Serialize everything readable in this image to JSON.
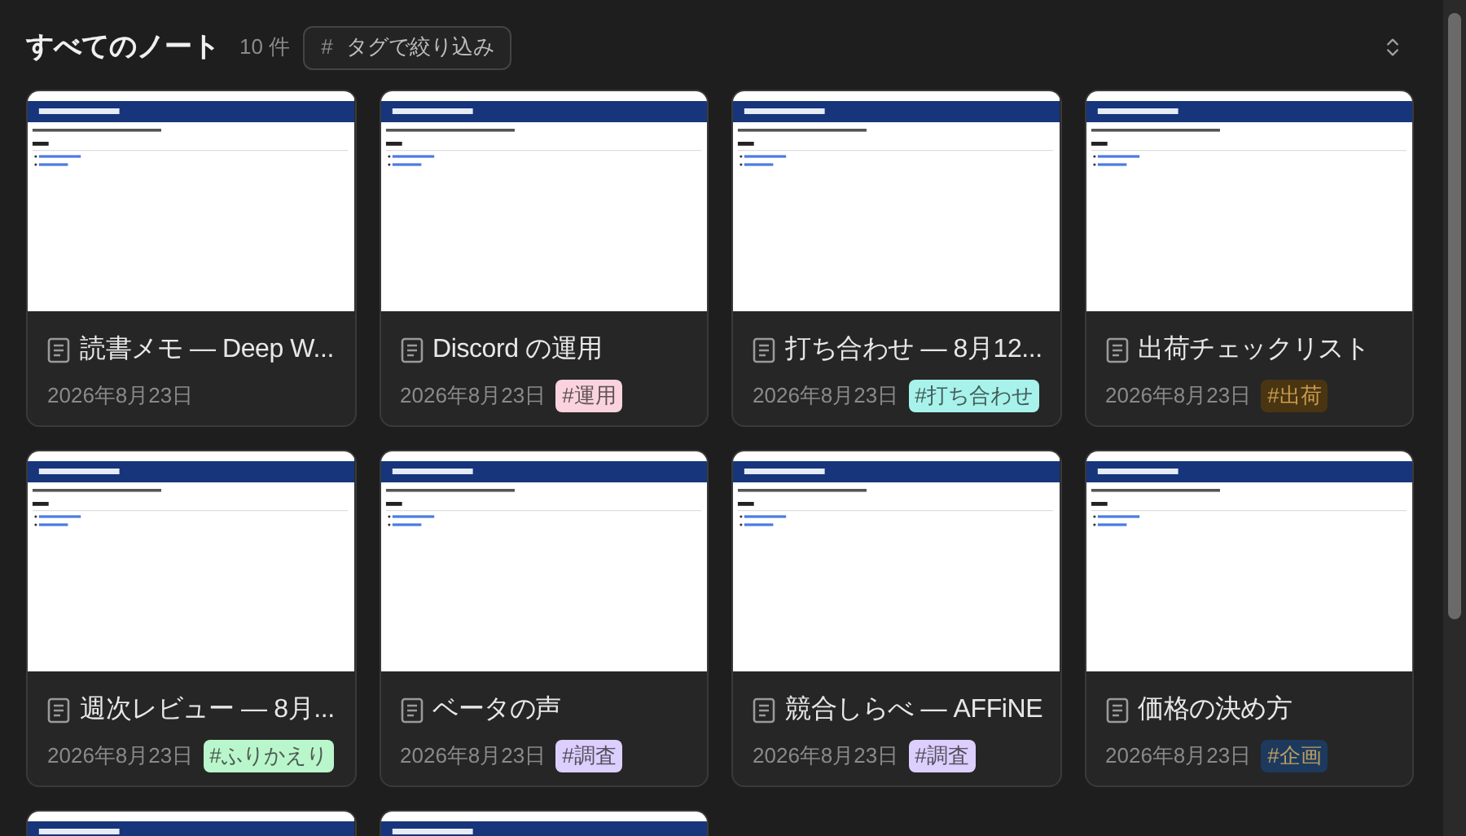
{
  "header": {
    "title": "すべてのノート",
    "count": "10 件",
    "filter_button": {
      "icon": "#",
      "label": "タグで絞り込み"
    }
  },
  "notes": [
    {
      "kind": "full",
      "title": "読書メモ — Deep W...",
      "date": "2026年8月23日"
    },
    {
      "kind": "full",
      "title": "Discord の運用",
      "date": "2026年8月23日",
      "tag": {
        "label": "運用",
        "color": "#fbd3df"
      }
    },
    {
      "kind": "full",
      "title": "打ち合わせ — 8月12...",
      "date": "2026年8月23日",
      "tag": {
        "label": "打ち合わせ",
        "color": "#a7f3eb"
      }
    },
    {
      "kind": "full",
      "title": "出荷チェックリスト",
      "date": "2026年8月23日",
      "tag": {
        "label": "出荷",
        "color": "#4a3512"
      }
    },
    {
      "kind": "full",
      "title": "週次レビュー — 8月...",
      "date": "2026年8月23日",
      "tag": {
        "label": "ふりかえり",
        "color": "#b9f6cc"
      }
    },
    {
      "kind": "full",
      "title": "ベータの声",
      "date": "2026年8月23日",
      "tag": {
        "label": "調査",
        "color": "#dccffd"
      }
    },
    {
      "kind": "full",
      "title": "競合しらべ — AFFiNE",
      "date": "2026年8月23日",
      "tag": {
        "label": "調査",
        "color": "#dccffd"
      }
    },
    {
      "kind": "full",
      "title": "価格の決め方",
      "date": "2026年8月23日",
      "tag": {
        "label": "企画",
        "color": "#1d3a5e"
      }
    },
    {
      "kind": "preview_only"
    },
    {
      "kind": "preview_only"
    }
  ]
}
